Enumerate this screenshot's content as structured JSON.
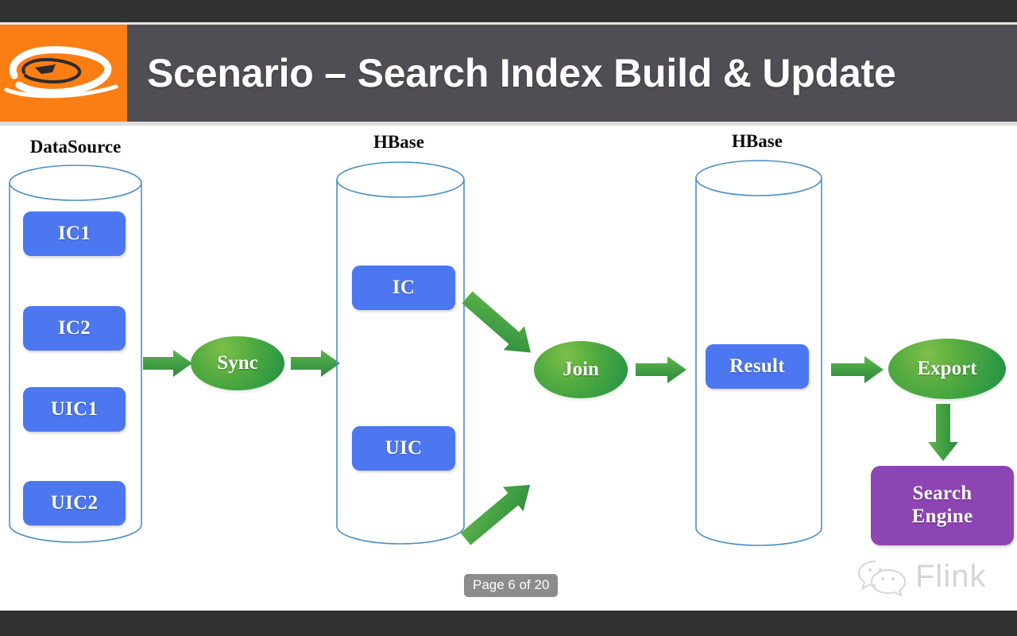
{
  "window": {
    "top_bar_color": "#313131",
    "bottom_bar_color": "#313131"
  },
  "header": {
    "title": "Scenario – Search Index Build & Update",
    "background_color": "#504E54",
    "logo": {
      "name": "alibaba-logo",
      "background_color": "#FB7E14"
    }
  },
  "diagram": {
    "colors": {
      "box_blue": "#4D77F0",
      "box_purple": "#8E45B4",
      "flow_green": "#3E9E42",
      "cylinder_stroke": "#4A90C2"
    },
    "cylinders": [
      {
        "label": "DataSource",
        "items": [
          {
            "label": "IC1"
          },
          {
            "label": "IC2"
          },
          {
            "label": "UIC1"
          },
          {
            "label": "UIC2"
          }
        ]
      },
      {
        "label": "HBase",
        "items": [
          {
            "label": "IC"
          },
          {
            "label": "UIC"
          }
        ]
      },
      {
        "label": "HBase",
        "items": [
          {
            "label": "Result"
          }
        ]
      }
    ],
    "processes": [
      {
        "label": "Sync"
      },
      {
        "label": "Join"
      },
      {
        "label": "Export"
      }
    ],
    "sink": {
      "label_line1": "Search",
      "label_line2": "Engine"
    }
  },
  "footer": {
    "page_indicator": "Page 6 of 20",
    "watermark": {
      "icon": "wechat-icon",
      "text": "Flink"
    }
  }
}
